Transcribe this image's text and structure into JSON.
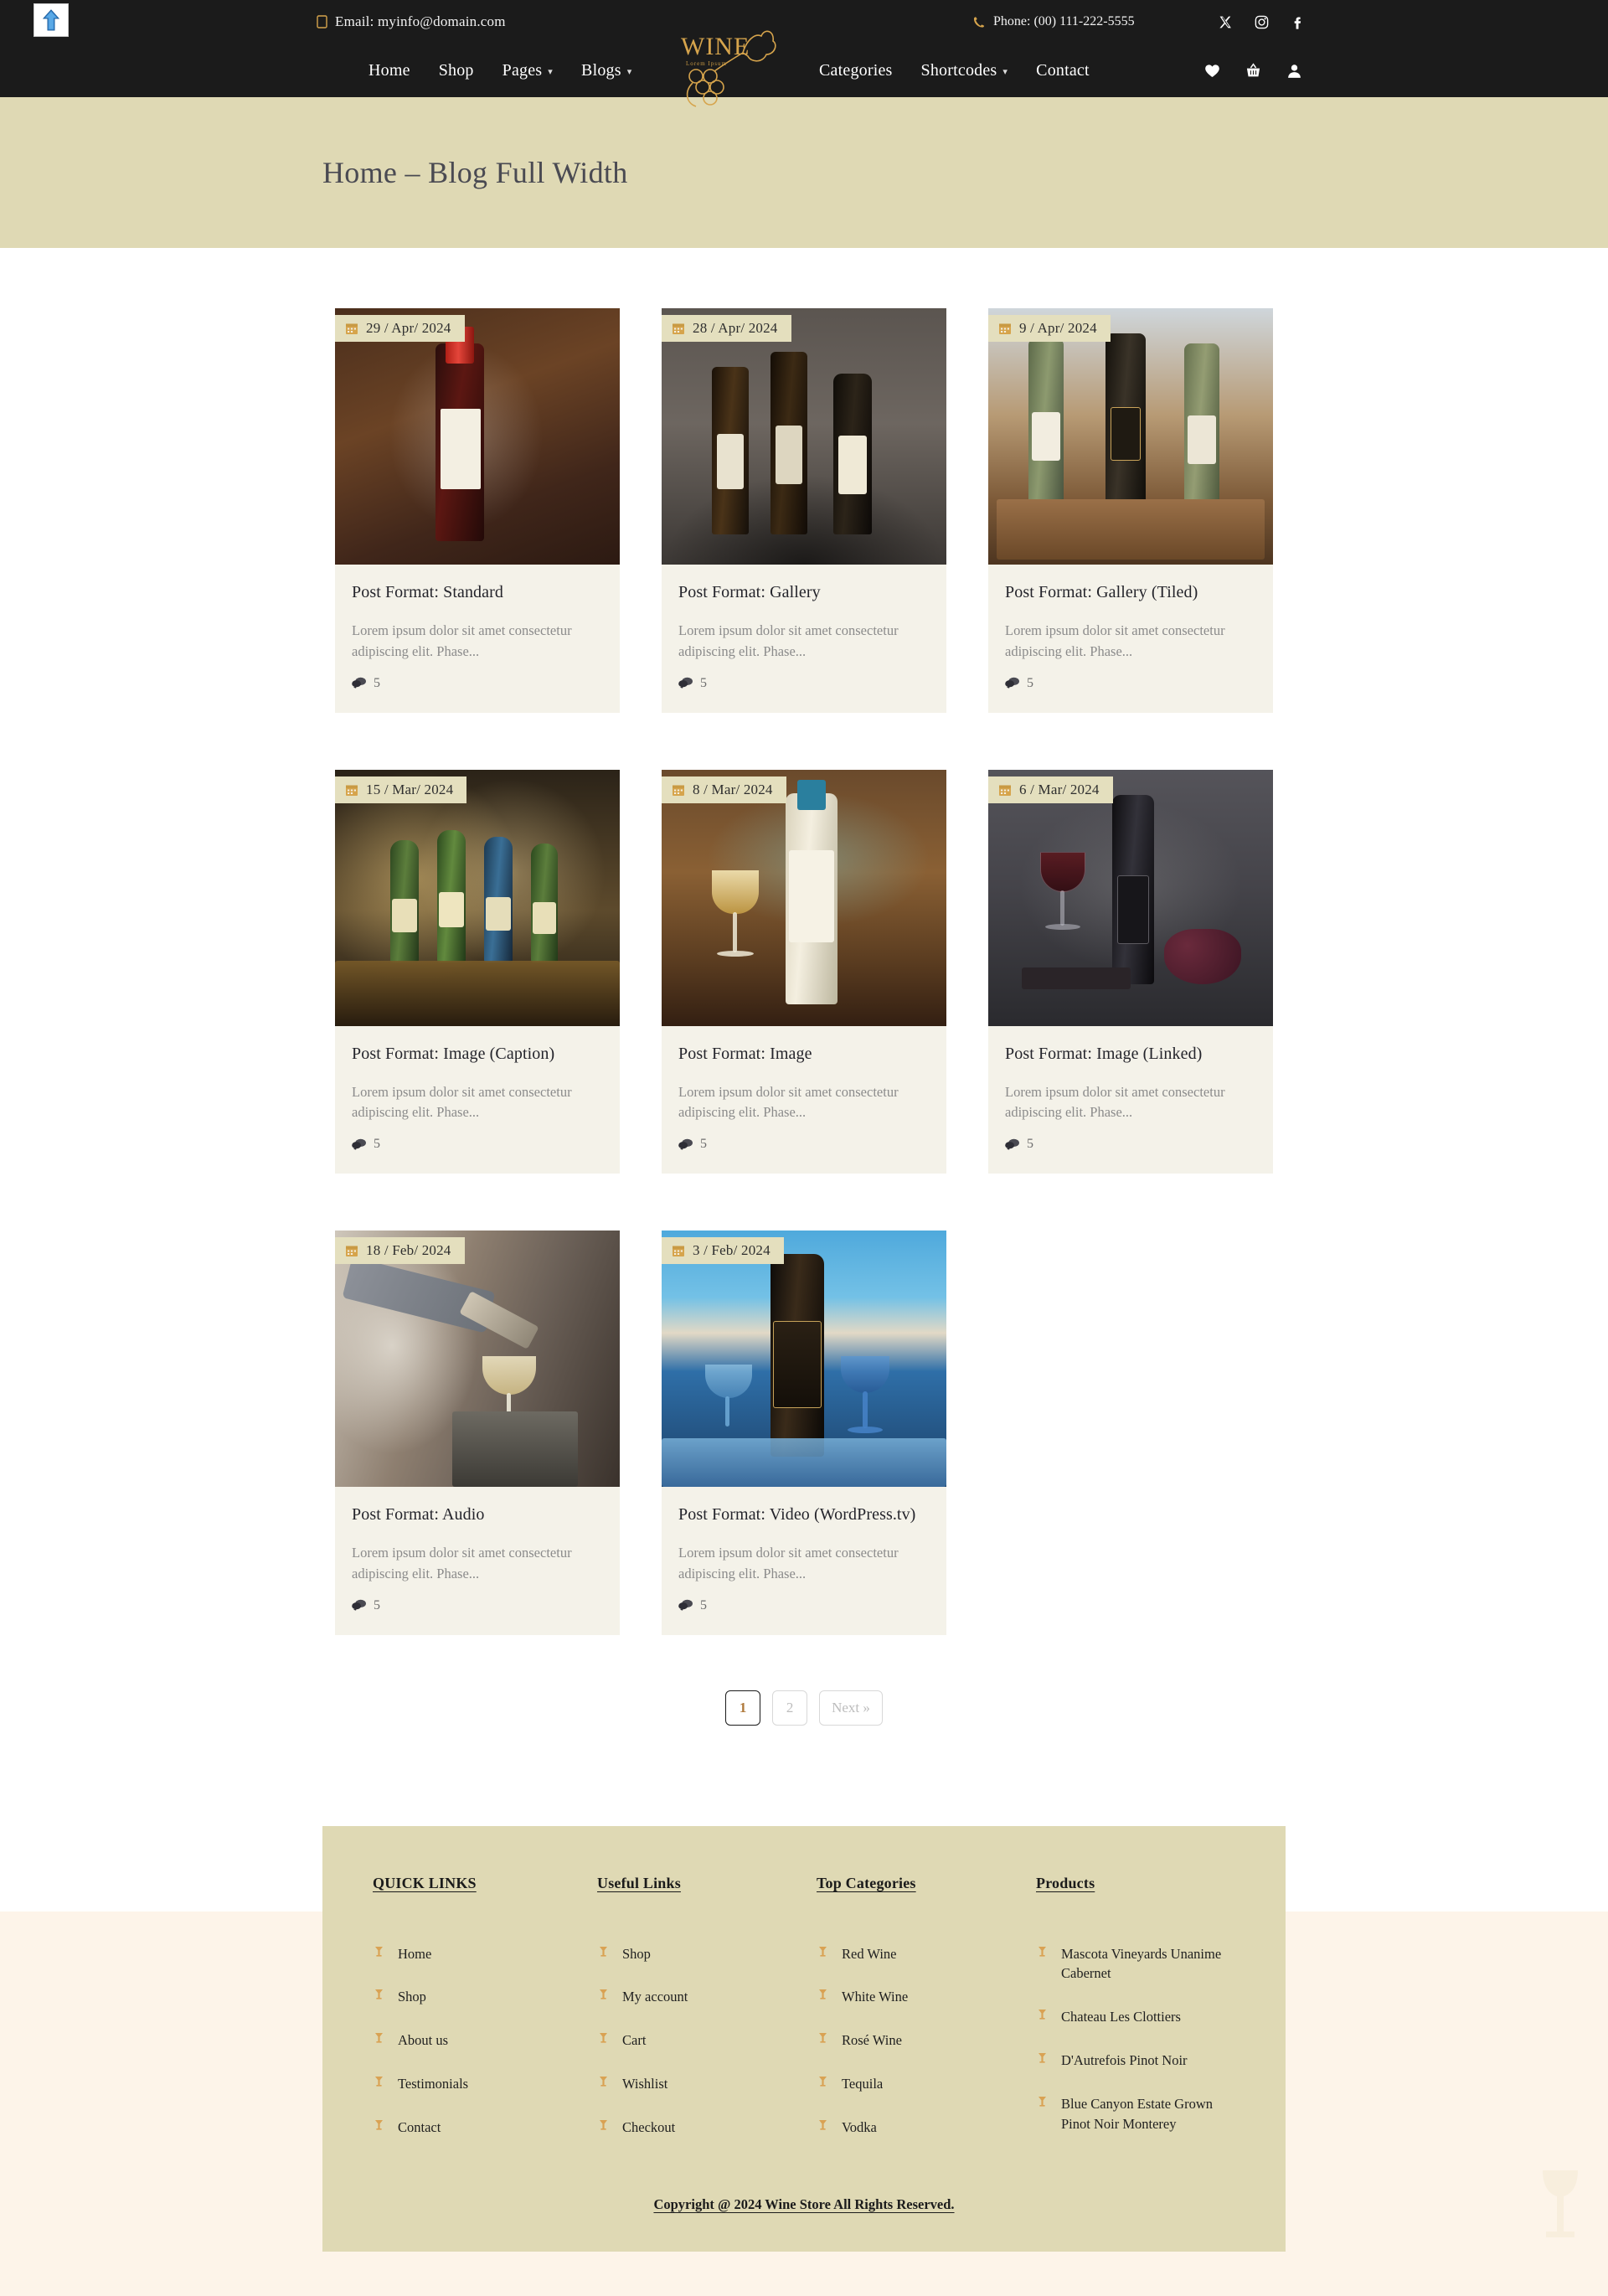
{
  "header": {
    "email_label": "Email: myinfo@domain.com",
    "phone_label": "Phone: (00) 111-222-5555",
    "logo_text": "WINE",
    "logo_sub": "Lorem Ipsum",
    "nav_left": [
      {
        "label": "Home",
        "has_caret": false
      },
      {
        "label": "Shop",
        "has_caret": false
      },
      {
        "label": "Pages",
        "has_caret": true
      },
      {
        "label": "Blogs",
        "has_caret": true
      }
    ],
    "nav_right": [
      {
        "label": "Categories",
        "has_caret": false
      },
      {
        "label": "Shortcodes",
        "has_caret": true
      },
      {
        "label": "Contact",
        "has_caret": false
      }
    ],
    "socials": [
      "x-icon",
      "instagram-icon",
      "facebook-icon"
    ],
    "action_icons": [
      "heart-icon",
      "basket-icon",
      "user-icon"
    ]
  },
  "title_bar": {
    "title": "Home – Blog Full Width"
  },
  "posts": [
    {
      "date": "29 / Apr/ 2024",
      "title": "Post Format: Standard",
      "excerpt": "Lorem ipsum dolor sit amet consectetur adipiscing elit. Phase...",
      "comments": "5",
      "art": "ph-1"
    },
    {
      "date": "28 / Apr/ 2024",
      "title": "Post Format: Gallery",
      "excerpt": "Lorem ipsum dolor sit amet consectetur adipiscing elit. Phase...",
      "comments": "5",
      "art": "ph-2"
    },
    {
      "date": "9 / Apr/ 2024",
      "title": "Post Format: Gallery (Tiled)",
      "excerpt": "Lorem ipsum dolor sit amet consectetur adipiscing elit. Phase...",
      "comments": "5",
      "art": "ph-3"
    },
    {
      "date": "15 / Mar/ 2024",
      "title": "Post Format: Image (Caption)",
      "excerpt": "Lorem ipsum dolor sit amet consectetur adipiscing elit. Phase...",
      "comments": "5",
      "art": "ph-4"
    },
    {
      "date": "8 / Mar/ 2024",
      "title": "Post Format: Image",
      "excerpt": "Lorem ipsum dolor sit amet consectetur adipiscing elit. Phase...",
      "comments": "5",
      "art": "ph-5"
    },
    {
      "date": "6 / Mar/ 2024",
      "title": "Post Format: Image (Linked)",
      "excerpt": "Lorem ipsum dolor sit amet consectetur adipiscing elit. Phase...",
      "comments": "5",
      "art": "ph-6"
    },
    {
      "date": "18 / Feb/ 2024",
      "title": "Post Format: Audio",
      "excerpt": "Lorem ipsum dolor sit amet consectetur adipiscing elit. Phase...",
      "comments": "5",
      "art": "ph-7"
    },
    {
      "date": "3 / Feb/ 2024",
      "title": "Post Format: Video (WordPress.tv)",
      "excerpt": "Lorem ipsum dolor sit amet consectetur adipiscing elit. Phase...",
      "comments": "5",
      "art": "ph-8"
    }
  ],
  "pagination": [
    {
      "label": "1",
      "active": true
    },
    {
      "label": "2",
      "active": false
    },
    {
      "label": "Next »",
      "active": false
    }
  ],
  "footer": {
    "columns": [
      {
        "heading": "QUICK LINKS",
        "links": [
          "Home",
          "Shop",
          "About us",
          "Testimonials",
          "Contact"
        ]
      },
      {
        "heading": "Useful Links",
        "links": [
          "Shop",
          "My account",
          "Cart",
          "Wishlist",
          "Checkout"
        ]
      },
      {
        "heading": "Top Categories",
        "links": [
          "Red Wine",
          "White Wine",
          "Rosé Wine",
          "Tequila",
          "Vodka"
        ]
      },
      {
        "heading": "Products",
        "links": [
          "Mascota Vineyards Unanime Cabernet",
          "Chateau Les Clottiers",
          "D'Autrefois Pinot Noir",
          "Blue Canyon Estate Grown Pinot Noir Monterey"
        ]
      }
    ],
    "copyright": "Copyright @ 2024 Wine Store All Rights Reserved."
  },
  "colors": {
    "header_bg": "#1b1b1b",
    "accent_gold": "#d6a44c",
    "title_bar_bg": "#dfd9b4",
    "card_bg": "#f4f2e9",
    "page_bg": "#fdf4e9",
    "active_page": "#b07a3c"
  }
}
